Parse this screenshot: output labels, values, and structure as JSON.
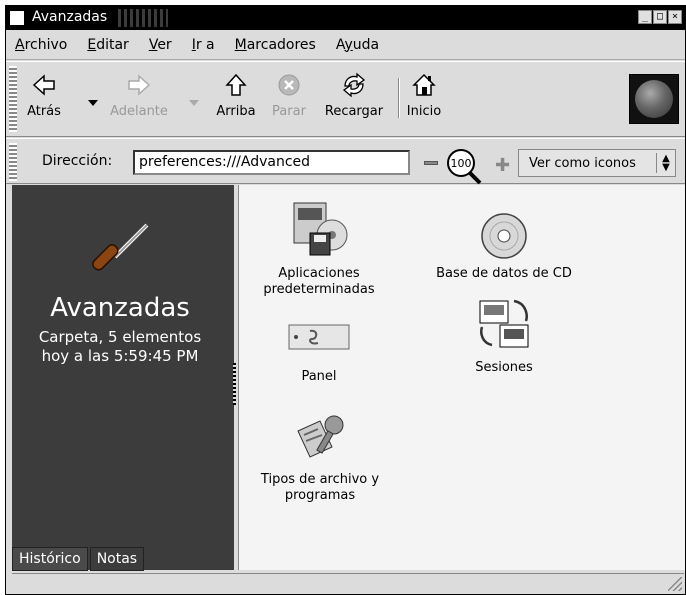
{
  "window": {
    "title": "Avanzadas"
  },
  "menu": [
    {
      "label": "Archivo",
      "hotkey": "A"
    },
    {
      "label": "Editar",
      "hotkey": "E"
    },
    {
      "label": "Ver",
      "hotkey": "V"
    },
    {
      "label": "Ir a",
      "hotkey": "I"
    },
    {
      "label": "Marcadores",
      "hotkey": "M"
    },
    {
      "label": "Ayuda",
      "hotkey": "y"
    }
  ],
  "toolbar": {
    "back": "Atrás",
    "forward": "Adelante",
    "up": "Arriba",
    "stop": "Parar",
    "reload": "Recargar",
    "home": "Inicio"
  },
  "location": {
    "label": "Dirección:",
    "value": "preferences:///Advanced",
    "zoom": "100",
    "view_as": "Ver como iconos"
  },
  "sidebar": {
    "title": "Avanzadas",
    "info_line1": "Carpeta, 5 elementos",
    "info_line2": "hoy a las 5:59:45 PM",
    "tabs": [
      "Histórico",
      "Notas"
    ]
  },
  "files": [
    {
      "line1": "Aplicaciones",
      "line2": "predeterminadas"
    },
    {
      "line1": "Base de datos de CD",
      "line2": ""
    },
    {
      "line1": "Panel",
      "line2": ""
    },
    {
      "line1": "Sesiones",
      "line2": ""
    },
    {
      "line1": "Tipos de archivo y",
      "line2": "programas"
    }
  ],
  "colors": {
    "sidebar_bg": "#3c3c3c",
    "window_bg": "#dcdcdc",
    "titlebar_bg": "#000000",
    "content_bg": "#f4f4f4"
  }
}
